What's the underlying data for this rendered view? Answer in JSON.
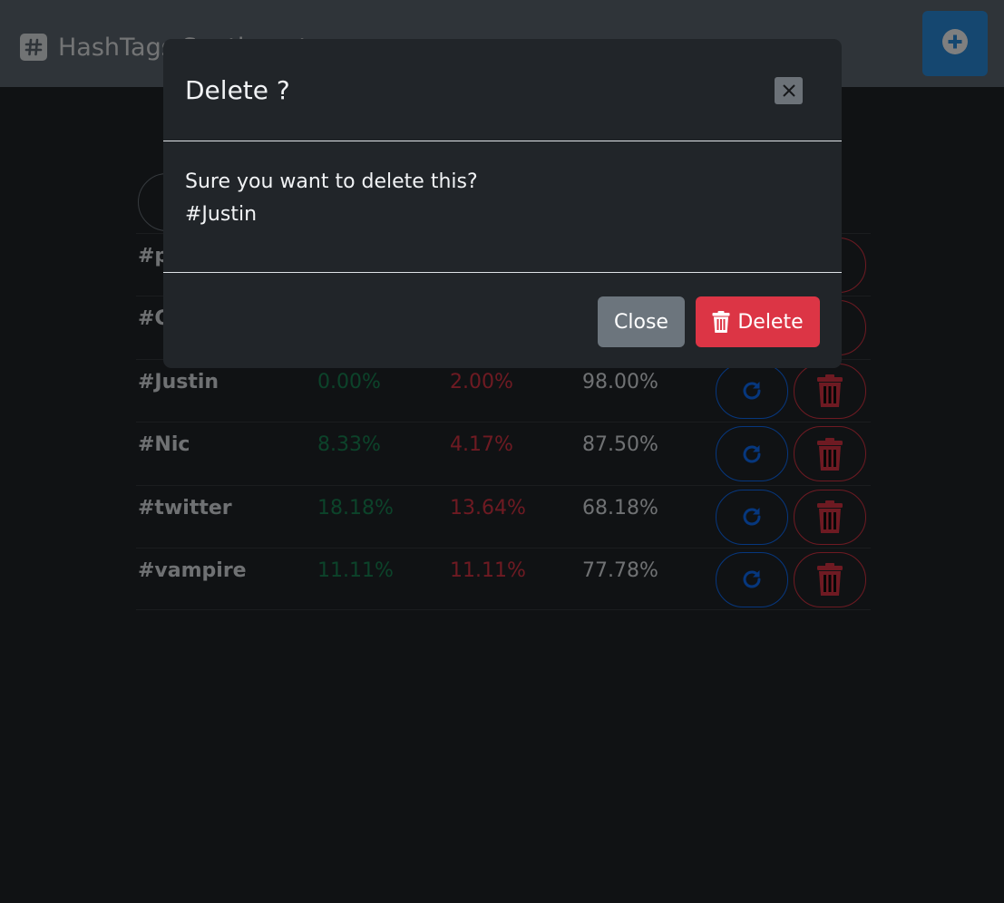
{
  "navbar": {
    "brand_title": "HashTags Sentiment",
    "brand_icon": "hashtag-icon",
    "add_icon": "plus-circle-icon"
  },
  "table": {
    "rows": [
      {
        "tag": "#p",
        "positive": "",
        "negative": "",
        "neutral": ""
      },
      {
        "tag": "#C",
        "positive": "",
        "negative": "",
        "neutral": ""
      },
      {
        "tag": "#Justin",
        "positive": "0.00%",
        "negative": "2.00%",
        "neutral": "98.00%"
      },
      {
        "tag": "#Nic",
        "positive": "8.33%",
        "negative": "4.17%",
        "neutral": "87.50%"
      },
      {
        "tag": "#twitter",
        "positive": "18.18%",
        "negative": "13.64%",
        "neutral": "68.18%"
      },
      {
        "tag": "#vampire",
        "positive": "11.11%",
        "negative": "11.11%",
        "neutral": "77.78%"
      }
    ],
    "refresh_icon": "refresh-icon",
    "delete_icon": "trash-icon"
  },
  "modal": {
    "title": "Delete ?",
    "message": "Sure you want to delete this?",
    "item": "#Justin",
    "close_label": "Close",
    "delete_label": "Delete",
    "close_icon": "close-icon"
  },
  "colors": {
    "positive": "#198754",
    "negative": "#dc3545",
    "primary": "#0d6efd",
    "secondary": "#6c757d"
  }
}
